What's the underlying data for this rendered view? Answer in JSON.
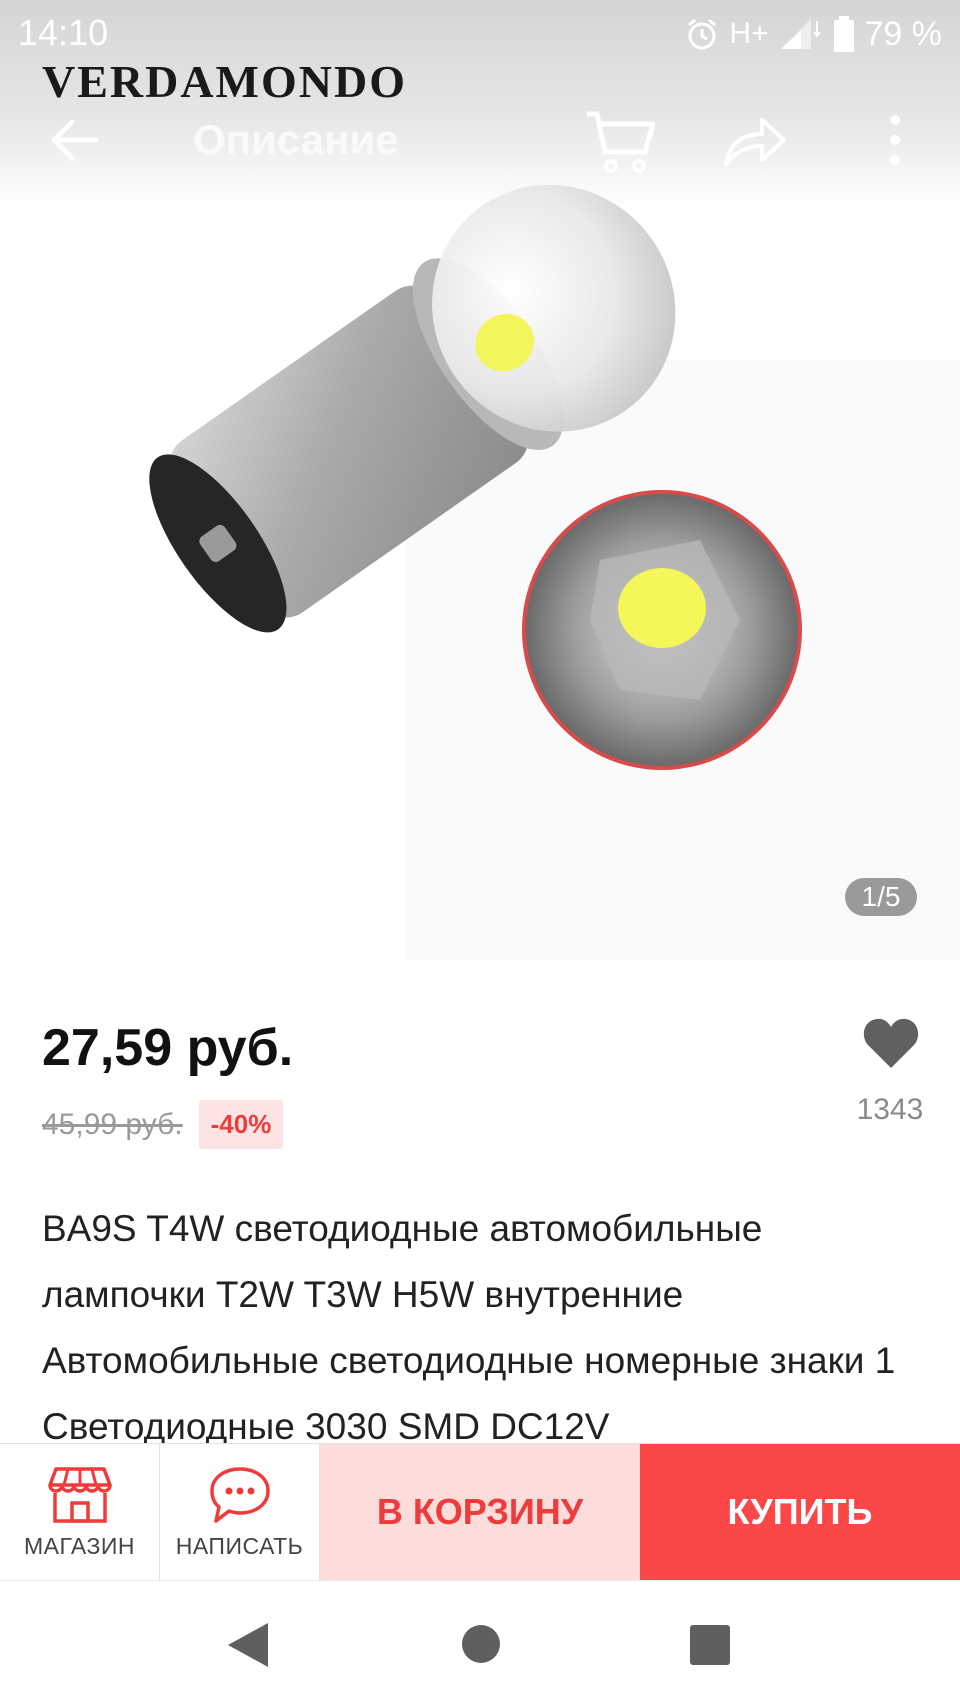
{
  "status_bar": {
    "time": "14:10",
    "network": "H+",
    "battery": "79 %"
  },
  "brand": "VERDAMONDO",
  "toolbar": {
    "title": "Описание",
    "icons": [
      "back-arrow-icon",
      "cart-icon",
      "share-icon",
      "more-vert-icon"
    ]
  },
  "gallery": {
    "pager": "1/5"
  },
  "product": {
    "price": "27,59 руб.",
    "old_price": "45,99 руб.",
    "discount": "-40%",
    "favorites_count": "1343",
    "description": "BA9S T4W светодиодные автомобильные лампочки T2W T3W H5W внутренние Автомобильные светодиодные номерные знаки 1 Светодиодные 3030 SMD DC12V"
  },
  "actions": {
    "store_label": "МАГАЗИН",
    "message_label": "НАПИСАТЬ",
    "add_to_cart_label": "В КОРЗИНУ",
    "buy_label": "КУПИТЬ"
  },
  "colors": {
    "accent_red": "#fb4747",
    "cart_bg": "#fddcdc",
    "cart_text": "#ee3b3b"
  }
}
